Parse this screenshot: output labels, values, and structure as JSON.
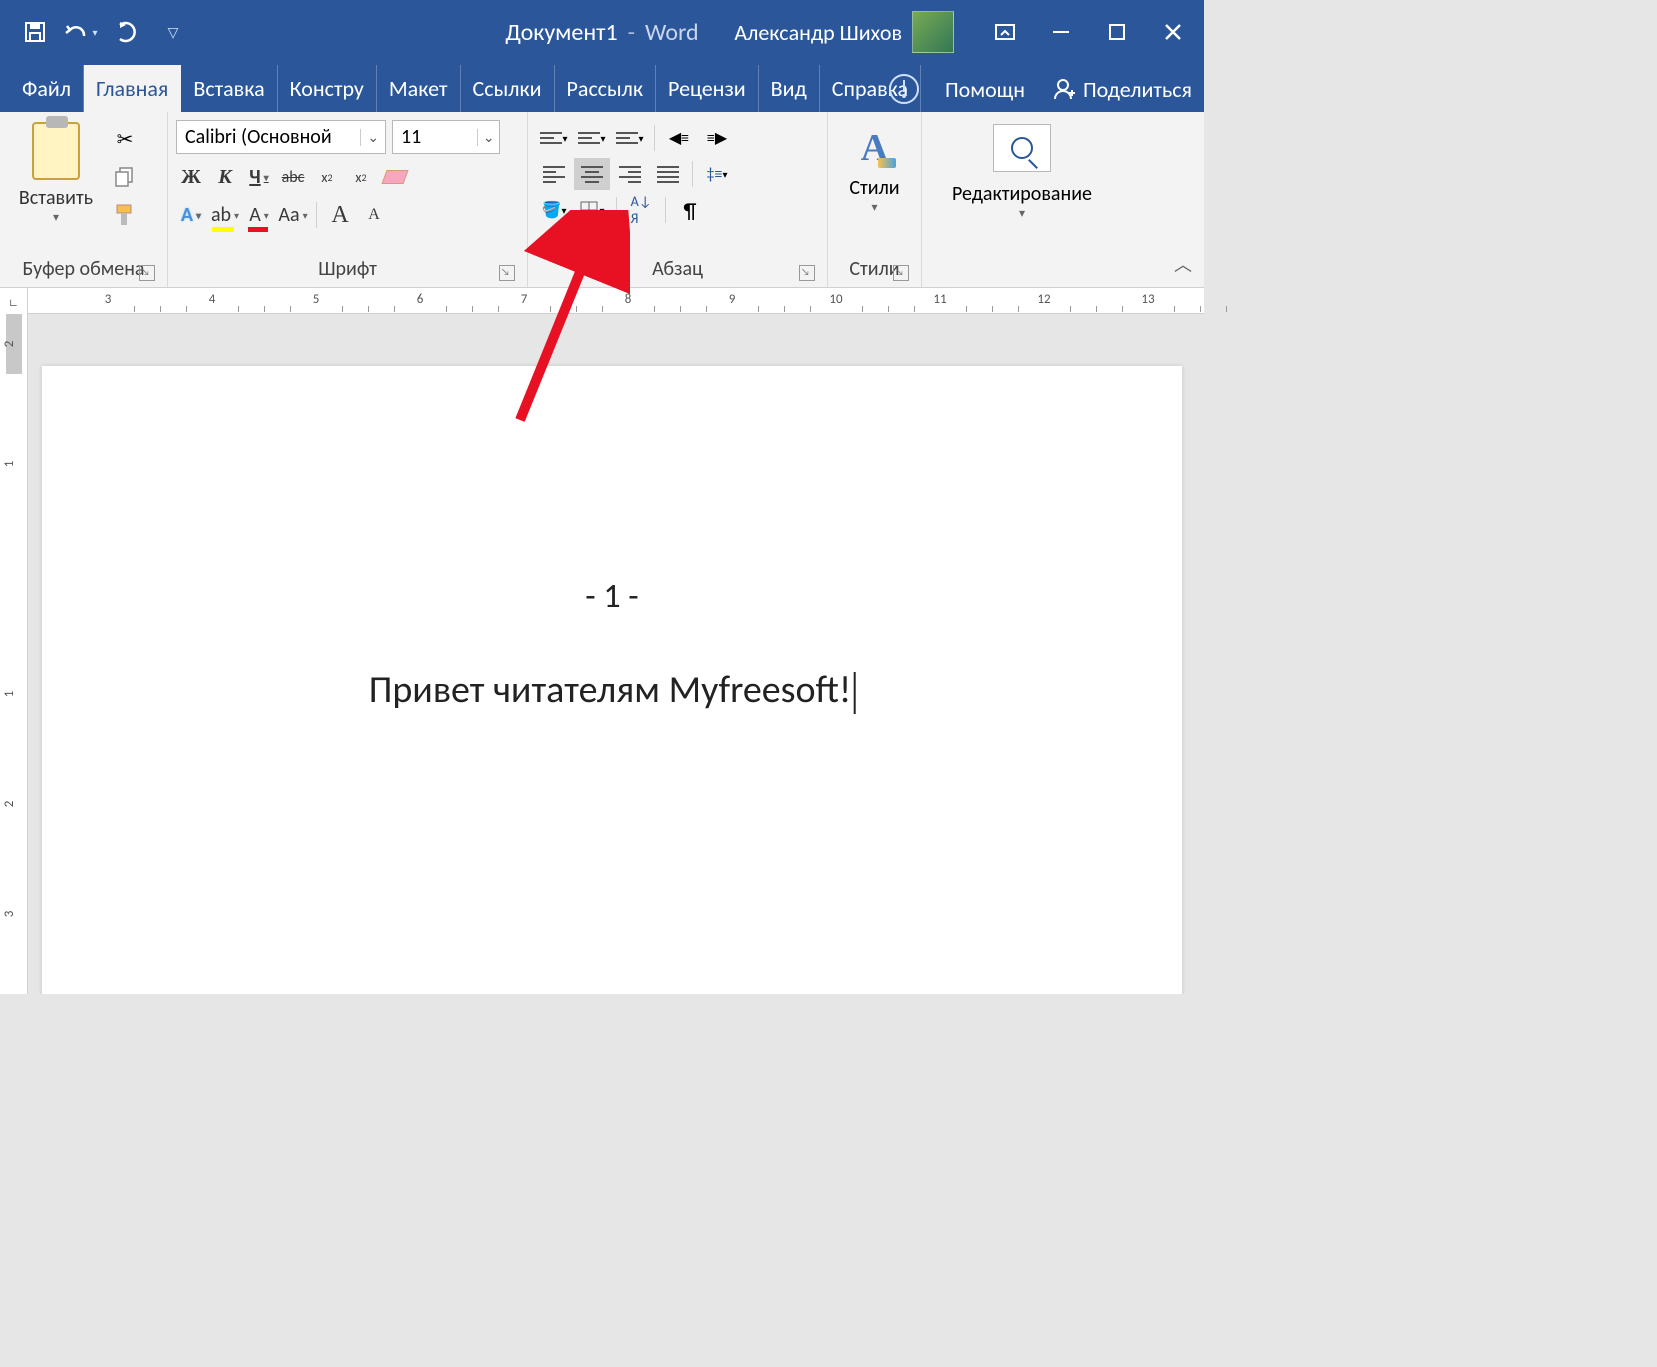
{
  "titlebar": {
    "document_name": "Документ1",
    "app_name": "Word",
    "user_name": "Александр Шихов"
  },
  "tabs": {
    "file": "Файл",
    "home": "Главная",
    "insert": "Вставка",
    "design": "Констру",
    "layout": "Макет",
    "references": "Ссылки",
    "mailings": "Рассылк",
    "review": "Рецензи",
    "view": "Вид",
    "help": "Справка",
    "tell_me": "Помощн",
    "share": "Поделиться"
  },
  "ribbon": {
    "clipboard": {
      "paste": "Вставить",
      "caption": "Буфер обмена"
    },
    "font": {
      "name": "Calibri (Основной",
      "size": "11",
      "caption": "Шрифт",
      "bold": "Ж",
      "italic": "К",
      "underline": "Ч",
      "strike": "abc",
      "sub": "x",
      "sup": "x",
      "case": "Aa",
      "grow": "A",
      "shrink": "A",
      "effects": "A",
      "highlight": "ab",
      "color": "A"
    },
    "paragraph": {
      "caption": "Абзац"
    },
    "styles": {
      "label": "Стили",
      "caption": "Стили"
    },
    "editing": {
      "label": "Редактирование"
    }
  },
  "ruler": {
    "h_numbers": [
      "3",
      "4",
      "5",
      "6",
      "7",
      "8",
      "9",
      "10",
      "11",
      "12",
      "13"
    ],
    "v_numbers": [
      "2",
      "1",
      "1",
      "2",
      "3"
    ]
  },
  "document": {
    "header": "- 1 -",
    "body": "Привет читателям Myfreesoft!"
  }
}
